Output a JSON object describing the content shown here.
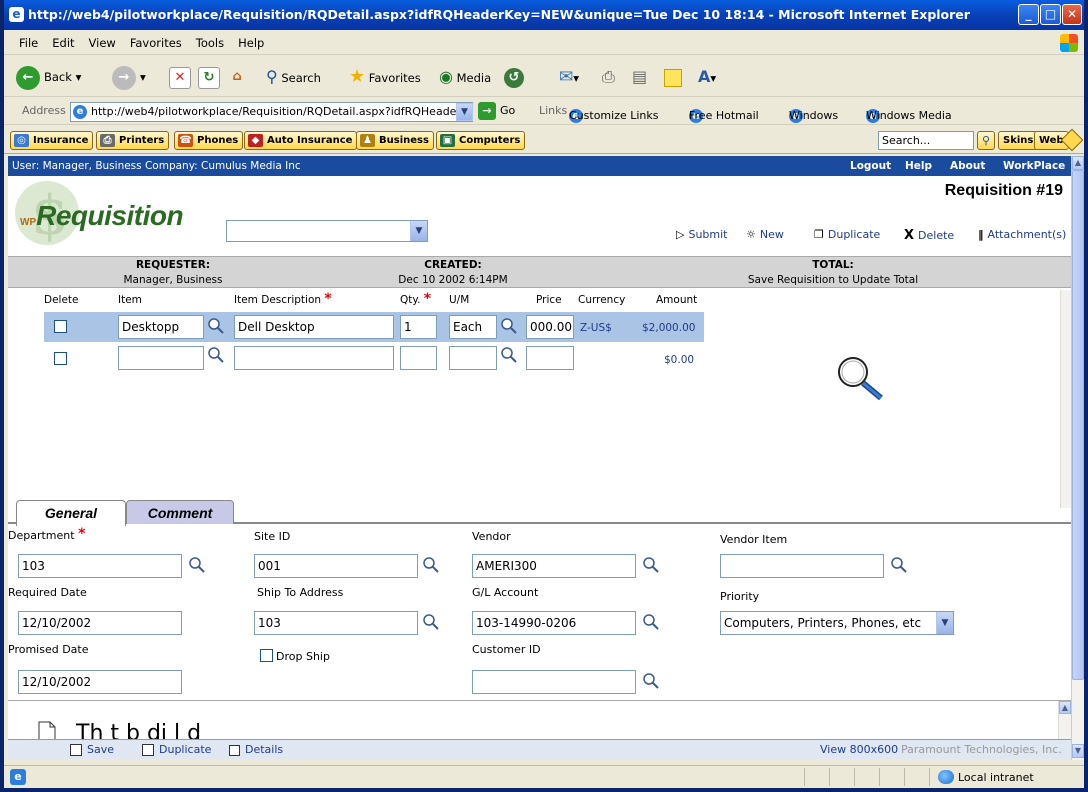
{
  "window": {
    "title": "http://web4/pilotworkplace/Requisition/RQDetail.aspx?idfRQHeaderKey=NEW&unique=Tue Dec 10 18:14 - Microsoft Internet Explorer"
  },
  "menu": [
    "File",
    "Edit",
    "View",
    "Favorites",
    "Tools",
    "Help"
  ],
  "toolbar": {
    "back": "Back",
    "search": "Search",
    "favorites": "Favorites",
    "media": "Media"
  },
  "address": {
    "label": "Address",
    "url": "http://web4/pilotworkplace/Requisition/RQDetail.aspx?idfRQHeaderKey",
    "go": "Go",
    "links_label": "Links",
    "links": [
      "Customize Links",
      "Free Hotmail",
      "Windows",
      "Windows Media"
    ]
  },
  "search_toolbar": {
    "buttons": [
      "Insurance",
      "Printers",
      "Phones",
      "Auto Insurance",
      "Business",
      "Computers"
    ],
    "search_value": "Search...",
    "skins": "Skins",
    "web": "Web"
  },
  "app": {
    "user_info": "User: Manager, Business   Company: Cumulus Media Inc",
    "top_links": [
      "Logout",
      "Help",
      "About",
      "WorkPlace"
    ],
    "logo_prefix": "WP",
    "logo_text": "Requisition",
    "requisition_title": "Requisition #19",
    "template_select": "",
    "actions": [
      "Submit",
      "New",
      "Duplicate",
      "Delete",
      "Attachment(s)"
    ]
  },
  "summary": {
    "requester_label": "REQUESTER:",
    "requester_value": "Manager, Business",
    "created_label": "CREATED:",
    "created_value": "Dec 10 2002 6:14PM",
    "total_label": "TOTAL:",
    "total_value": "Save Requisition to Update Total"
  },
  "grid": {
    "columns": [
      "Delete",
      "Item",
      "Item Description",
      "Qty.",
      "U/M",
      "Price",
      "Currency",
      "Amount"
    ],
    "rows": [
      {
        "item": "Desktopp",
        "description": "Dell Desktop",
        "qty": "1",
        "um": "Each",
        "price": "000.00",
        "currency": "Z-US$",
        "amount": "$2,000.00"
      },
      {
        "item": "",
        "description": "",
        "qty": "",
        "um": "",
        "price": "",
        "currency": "",
        "amount": "$0.00"
      }
    ]
  },
  "tabs": [
    "General",
    "Comment"
  ],
  "form": {
    "department_label": "Department",
    "department": "103",
    "site_label": "Site ID",
    "site": "001",
    "vendor_label": "Vendor",
    "vendor": "AMERI300",
    "vendor_item_label": "Vendor Item",
    "vendor_item": "",
    "required_date_label": "Required Date",
    "required_date": "12/10/2002",
    "ship_to_label": "Ship To Address",
    "ship_to": "103",
    "gl_label": "G/L Account",
    "gl": "103-14990-0206",
    "priority_label": "Priority",
    "priority": "Computers, Printers, Phones, etc",
    "promised_date_label": "Promised Date",
    "promised_date": "12/10/2002",
    "drop_ship_label": "Drop Ship",
    "customer_label": "Customer ID",
    "customer": ""
  },
  "bottom_panel": {
    "text": "Th                         t  b   di  l    d"
  },
  "footer": {
    "buttons": [
      "Save",
      "Duplicate",
      "Details"
    ],
    "view": "View 800x600",
    "copyright": "Paramount Technologies, Inc."
  },
  "status": {
    "zone": "Local intranet"
  }
}
